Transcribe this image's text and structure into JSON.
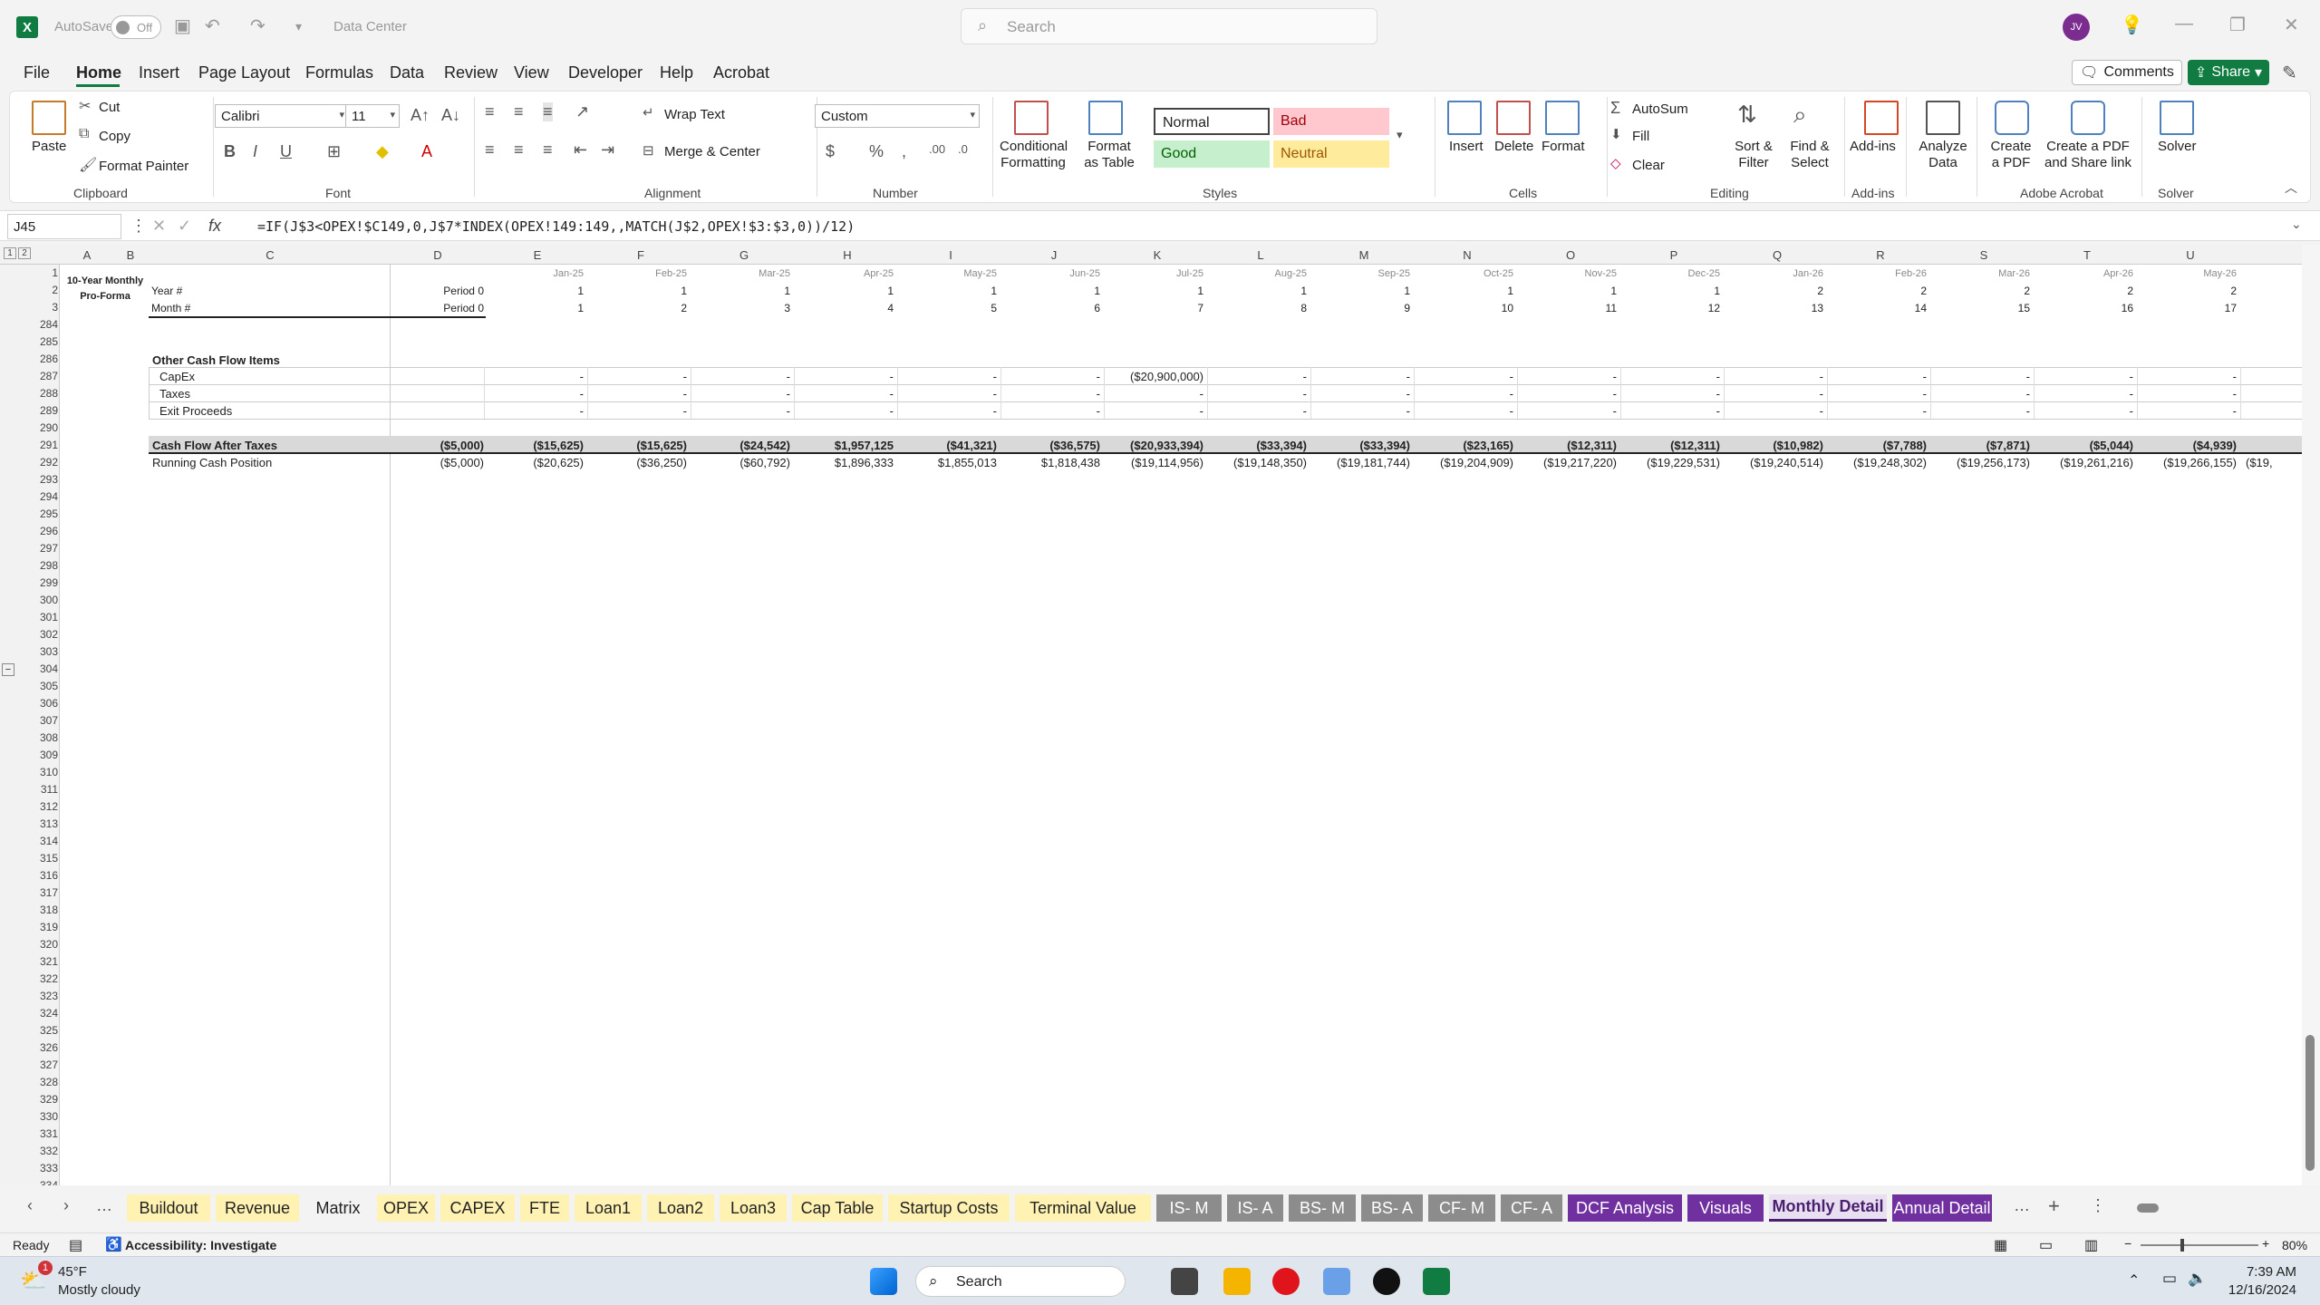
{
  "titlebar": {
    "autosave_label": "AutoSave",
    "autosave_state": "Off",
    "doc_title": "Data Center",
    "search_placeholder": "Search",
    "avatar": "JV"
  },
  "menu": [
    "File",
    "Home",
    "Insert",
    "Page Layout",
    "Formulas",
    "Data",
    "Review",
    "View",
    "Developer",
    "Help",
    "Acrobat"
  ],
  "actions": {
    "comments": "Comments",
    "share": "Share"
  },
  "ribbon": {
    "clipboard": {
      "paste": "Paste",
      "cut": "Cut",
      "copy": "Copy",
      "format_painter": "Format Painter",
      "label": "Clipboard"
    },
    "font": {
      "name": "Calibri",
      "size": "11",
      "label": "Font"
    },
    "alignment": {
      "wrap": "Wrap Text",
      "merge": "Merge & Center",
      "label": "Alignment"
    },
    "number": {
      "format": "Custom",
      "label": "Number"
    },
    "styles": {
      "cond_fmt": "Conditional Formatting",
      "fmt_table": "Format as Table",
      "normal": "Normal",
      "bad": "Bad",
      "good": "Good",
      "neutral": "Neutral",
      "label": "Styles"
    },
    "cells": {
      "insert": "Insert",
      "delete": "Delete",
      "format": "Format",
      "label": "Cells"
    },
    "editing": {
      "autosum": "AutoSum",
      "fill": "Fill",
      "clear": "Clear",
      "sort": "Sort & Filter",
      "find": "Find & Select",
      "label": "Editing"
    },
    "addins": {
      "addins": "Add-ins",
      "label": "Add-ins"
    },
    "analyze": {
      "label": "Analyze Data"
    },
    "acrobat": {
      "create_pdf": "Create a PDF",
      "create_share": "Create a PDF and Share link",
      "label": "Adobe Acrobat"
    },
    "solver": {
      "solver": "Solver",
      "label": "Solver"
    }
  },
  "formula_bar": {
    "name_box": "J45",
    "formula": "=IF(J$3<OPEX!$C149,0,J$7*INDEX(OPEX!149:149,,MATCH(J$2,OPEX!$3:$3,0))/12)"
  },
  "sheet": {
    "columns": [
      "A",
      "B",
      "C",
      "D",
      "E",
      "F",
      "G",
      "H",
      "I",
      "J",
      "K",
      "L",
      "M",
      "N",
      "O",
      "P",
      "Q",
      "R",
      "S",
      "T",
      "U"
    ],
    "title": "10-Year Monthly Pro-Forma",
    "months": [
      "Jan-25",
      "Feb-25",
      "Mar-25",
      "Apr-25",
      "May-25",
      "Jun-25",
      "Jul-25",
      "Aug-25",
      "Sep-25",
      "Oct-25",
      "Nov-25",
      "Dec-25",
      "Jan-26",
      "Feb-26",
      "Mar-26",
      "Apr-26",
      "May-26"
    ],
    "year_label": "Year #",
    "month_label": "Month #",
    "period0": "Period 0",
    "years": [
      "1",
      "1",
      "1",
      "1",
      "1",
      "1",
      "1",
      "1",
      "1",
      "1",
      "1",
      "1",
      "2",
      "2",
      "2",
      "2",
      "2"
    ],
    "month_nums": [
      "1",
      "2",
      "3",
      "4",
      "5",
      "6",
      "7",
      "8",
      "9",
      "10",
      "11",
      "12",
      "13",
      "14",
      "15",
      "16",
      "17"
    ],
    "section": "Other Cash Flow Items",
    "capex_label": "CapEx",
    "taxes_label": "Taxes",
    "exit_label": "Exit Proceeds",
    "capex": [
      "-",
      "-",
      "-",
      "-",
      "-",
      "-",
      "($20,900,000)",
      "-",
      "-",
      "-",
      "-",
      "-",
      "-",
      "-",
      "-",
      "-",
      "-"
    ],
    "dash": "-",
    "cfat_label": "Cash Flow After Taxes",
    "cfat_d": "($5,000)",
    "cfat": [
      "($15,625)",
      "($15,625)",
      "($24,542)",
      "$1,957,125",
      "($41,321)",
      "($36,575)",
      "($20,933,394)",
      "($33,394)",
      "($33,394)",
      "($23,165)",
      "($12,311)",
      "($12,311)",
      "($10,982)",
      "($7,788)",
      "($7,871)",
      "($5,044)",
      "($4,939)"
    ],
    "rcp_label": "Running Cash Position",
    "rcp_d": "($5,000)",
    "rcp": [
      "($20,625)",
      "($36,250)",
      "($60,792)",
      "$1,896,333",
      "$1,855,013",
      "$1,818,438",
      "($19,114,956)",
      "($19,148,350)",
      "($19,181,744)",
      "($19,204,909)",
      "($19,217,220)",
      "($19,229,531)",
      "($19,240,514)",
      "($19,248,302)",
      "($19,256,173)",
      "($19,261,216)",
      "($19,266,155)"
    ],
    "rcp_overflow": "($19,"
  },
  "tabs": [
    {
      "label": "Buildout",
      "bg": "#fff2b3",
      "fg": "#222"
    },
    {
      "label": "Revenue",
      "bg": "#fff2b3",
      "fg": "#222"
    },
    {
      "label": "Matrix",
      "bg": "#f3f3f3",
      "fg": "#222"
    },
    {
      "label": "OPEX",
      "bg": "#fff2b3",
      "fg": "#222"
    },
    {
      "label": "CAPEX",
      "bg": "#fff2b3",
      "fg": "#222"
    },
    {
      "label": "FTE",
      "bg": "#fff2b3",
      "fg": "#222"
    },
    {
      "label": "Loan1",
      "bg": "#fff2b3",
      "fg": "#222"
    },
    {
      "label": "Loan2",
      "bg": "#fff2b3",
      "fg": "#222"
    },
    {
      "label": "Loan3",
      "bg": "#fff2b3",
      "fg": "#222"
    },
    {
      "label": "Cap Table",
      "bg": "#fff2b3",
      "fg": "#222"
    },
    {
      "label": "Startup Costs",
      "bg": "#fff2b3",
      "fg": "#222"
    },
    {
      "label": "Terminal Value",
      "bg": "#fff2b3",
      "fg": "#222"
    },
    {
      "label": "IS- M",
      "bg": "#8c8c8c",
      "fg": "#fff"
    },
    {
      "label": "IS- A",
      "bg": "#8c8c8c",
      "fg": "#fff"
    },
    {
      "label": "BS- M",
      "bg": "#8c8c8c",
      "fg": "#fff"
    },
    {
      "label": "BS- A",
      "bg": "#8c8c8c",
      "fg": "#fff"
    },
    {
      "label": "CF- M",
      "bg": "#8c8c8c",
      "fg": "#fff"
    },
    {
      "label": "CF- A",
      "bg": "#8c8c8c",
      "fg": "#fff"
    },
    {
      "label": "DCF Analysis",
      "bg": "#7030a0",
      "fg": "#fff"
    },
    {
      "label": "Visuals",
      "bg": "#7030a0",
      "fg": "#fff"
    },
    {
      "label": "Monthly Detail",
      "bg": "#e8dff0",
      "fg": "#4b1f6f"
    },
    {
      "label": "Annual Detail",
      "bg": "#7030a0",
      "fg": "#fff"
    }
  ],
  "status": {
    "ready": "Ready",
    "accessibility": "Accessibility: Investigate",
    "zoom": "80%"
  },
  "taskbar": {
    "temp": "45°F",
    "weather": "Mostly cloudy",
    "search": "Search",
    "time": "7:39 AM",
    "date": "12/16/2024",
    "badge": "1"
  }
}
